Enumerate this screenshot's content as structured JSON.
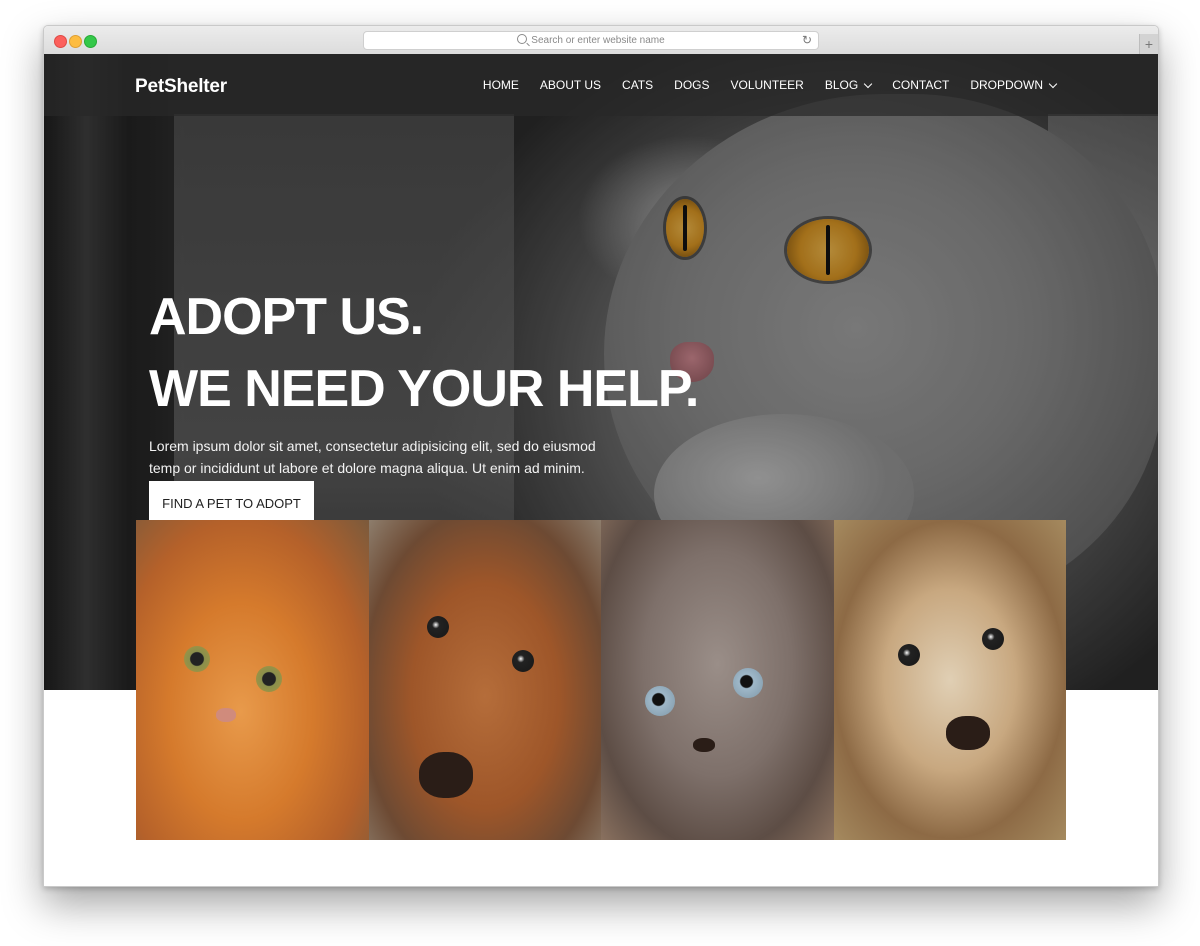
{
  "browser": {
    "url_placeholder": "Search or enter website name",
    "reload_icon": "reload-icon",
    "new_tab_label": "+"
  },
  "nav": {
    "brand": "PetShelter",
    "items": [
      {
        "label": "HOME",
        "dropdown": false
      },
      {
        "label": "ABOUT US",
        "dropdown": false
      },
      {
        "label": "CATS",
        "dropdown": false
      },
      {
        "label": "DOGS",
        "dropdown": false
      },
      {
        "label": "VOLUNTEER",
        "dropdown": false
      },
      {
        "label": "BLOG",
        "dropdown": true
      },
      {
        "label": "CONTACT",
        "dropdown": false
      },
      {
        "label": "DROPDOWN",
        "dropdown": true
      }
    ]
  },
  "hero": {
    "headline_line1": "ADOPT US.",
    "headline_line2": "WE NEED YOUR HELP.",
    "lead": "Lorem ipsum dolor sit amet, consectetur adipisicing elit, sed do eiusmod temp or incididunt ut labore et dolore magna aliqua. Ut enim ad minim.",
    "cta_label": "FIND A PET TO ADOPT"
  },
  "gallery": [
    {
      "name": "ginger-cat-photo"
    },
    {
      "name": "dachshund-photo"
    },
    {
      "name": "siamese-kitten-photo"
    },
    {
      "name": "puppy-photo"
    }
  ],
  "colors": {
    "nav_bg": "#282828",
    "cta_bg": "#ffffff",
    "text_light": "#ffffff"
  }
}
